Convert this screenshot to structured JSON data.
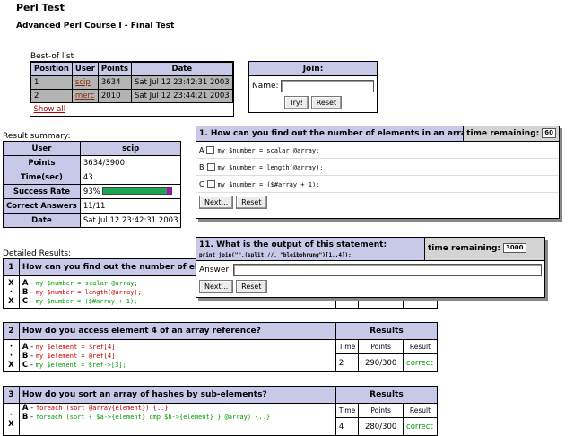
{
  "page": {
    "title": "Perl Test",
    "subtitle": "Advanced Perl Course I - Final Test"
  },
  "best_of": {
    "caption": "Best-of list",
    "headers": [
      "Position",
      "User",
      "Points",
      "Date"
    ],
    "rows": [
      {
        "position": "1",
        "user": "scip",
        "points": "3634",
        "date": "Sat Jul 12 23:42:31 2003"
      },
      {
        "position": "2",
        "user": "merc",
        "points": "2010",
        "date": "Sat Jul 12 23:44:21 2003"
      }
    ],
    "show_all": "Show all"
  },
  "join": {
    "title": "Join:",
    "name_label": "Name:",
    "name_value": "",
    "try_label": "Try!",
    "reset_label": "Reset"
  },
  "summary": {
    "caption": "Result summary:",
    "rows": [
      {
        "label": "User",
        "value": "scip"
      },
      {
        "label": "Points",
        "value": "3634/3900"
      },
      {
        "label": "Time(sec)",
        "value": "43"
      },
      {
        "label": "Success Rate",
        "value": "93%"
      },
      {
        "label": "Correct Answers",
        "value": "11/11"
      },
      {
        "label": "Date",
        "value": "Sat Jul 12 23:42:31 2003"
      }
    ],
    "success_rate_fraction": 0.93
  },
  "popup1": {
    "question": "1. How can you find out the number of elements in an array?",
    "time_label": "time remaining:",
    "time_value": "60",
    "options": [
      {
        "letter": "A",
        "code": "my $number = scalar @array;"
      },
      {
        "letter": "B",
        "code": "my $number = length(@array);"
      },
      {
        "letter": "C",
        "code": "my $number = ($#array + 1);"
      }
    ],
    "next_label": "Next...",
    "reset_label": "Reset"
  },
  "popup2": {
    "question": "11. What is the output of this statement:",
    "code": "print join(\"\",(split //, \"bleibohrung\")[1..4]);",
    "time_label": "time remaining:",
    "time_value": "3000",
    "answer_label": "Answer:",
    "answer_value": "",
    "next_label": "Next...",
    "reset_label": "Reset"
  },
  "detailed": {
    "caption": "Detailed Results:",
    "results_header": "Results",
    "col_headers": [
      "Time",
      "Points",
      "Result"
    ],
    "questions": [
      {
        "num": "1",
        "text": "How can you find out the number of el",
        "answers": [
          {
            "mark": "X",
            "letter": "A",
            "code": "my $number = scalar @array;",
            "color": "g"
          },
          {
            "mark": "",
            "letter": "B",
            "code": "my $number = length(@array);",
            "color": "r"
          },
          {
            "mark": "X",
            "letter": "C",
            "code": "my $number = ($#array + 1);",
            "color": "g"
          }
        ],
        "time": "",
        "points": "",
        "result": ""
      },
      {
        "num": "2",
        "text": "How do you access element 4 of an array reference?",
        "answers": [
          {
            "mark": "",
            "letter": "A",
            "code": "my $element = $ref[4];",
            "color": "r"
          },
          {
            "mark": "",
            "letter": "B",
            "code": "my $element = @ref[4];",
            "color": "r"
          },
          {
            "mark": "X",
            "letter": "C",
            "code": "my $element = $ref->[3];",
            "color": "g"
          }
        ],
        "time": "2",
        "points": "290/300",
        "result": "correct"
      },
      {
        "num": "3",
        "text": "How do you sort an array of hashes by sub-elements?",
        "answers": [
          {
            "mark": "",
            "letter": "A",
            "code": "foreach (sort @array{element}) {..}",
            "color": "r"
          },
          {
            "mark": "X",
            "letter": "B",
            "code": "foreach (sort { $a->{element} cmp $b->{element} } @array) {..}",
            "color": "g"
          }
        ],
        "time": "4",
        "points": "280/300",
        "result": "correct"
      }
    ]
  }
}
